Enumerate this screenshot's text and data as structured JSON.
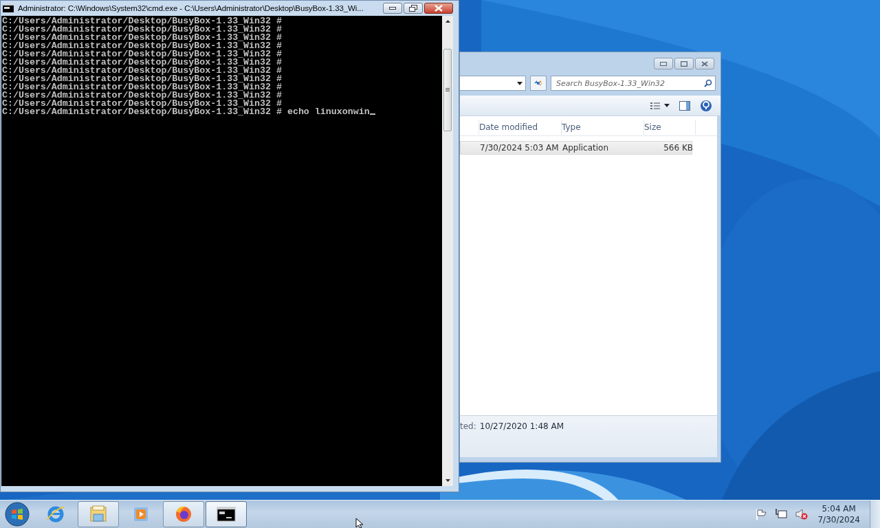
{
  "cmd_window": {
    "title": "Administrator: C:\\Windows\\System32\\cmd.exe - C:\\Users\\Administrator\\Desktop\\BusyBox-1.33_Wi...",
    "active": true,
    "lines": [
      "C:/Users/Administrator/Desktop/BusyBox-1.33_Win32 #",
      "C:/Users/Administrator/Desktop/BusyBox-1.33_Win32 #",
      "C:/Users/Administrator/Desktop/BusyBox-1.33_Win32 #",
      "C:/Users/Administrator/Desktop/BusyBox-1.33_Win32 #",
      "C:/Users/Administrator/Desktop/BusyBox-1.33_Win32 #",
      "C:/Users/Administrator/Desktop/BusyBox-1.33_Win32 #",
      "C:/Users/Administrator/Desktop/BusyBox-1.33_Win32 #",
      "C:/Users/Administrator/Desktop/BusyBox-1.33_Win32 #",
      "C:/Users/Administrator/Desktop/BusyBox-1.33_Win32 #",
      "C:/Users/Administrator/Desktop/BusyBox-1.33_Win32 #",
      "C:/Users/Administrator/Desktop/BusyBox-1.33_Win32 #",
      "C:/Users/Administrator/Desktop/BusyBox-1.33_Win32 # echo linuxonwin"
    ]
  },
  "explorer_window": {
    "search": {
      "placeholder": "Search BusyBox-1.33_Win32"
    },
    "columns": [
      "Date modified",
      "Type",
      "Size"
    ],
    "rows": [
      {
        "date_modified": "7/30/2024 5:03 AM",
        "type": "Application",
        "size": "566 KB",
        "selected": true
      }
    ],
    "details": {
      "label": "ted:",
      "value": "10/27/2020 1:48 AM"
    }
  },
  "taskbar": {
    "items": [
      {
        "kind": "ie",
        "running": false,
        "active": false
      },
      {
        "kind": "folder",
        "running": true,
        "active": false
      },
      {
        "kind": "media",
        "running": false,
        "active": false
      },
      {
        "kind": "firefox",
        "running": true,
        "active": false
      },
      {
        "kind": "console",
        "running": true,
        "active": true
      }
    ],
    "tray": {
      "volume_muted": true
    },
    "clock": {
      "time": "5:04 AM",
      "date": "7/30/2024"
    }
  }
}
